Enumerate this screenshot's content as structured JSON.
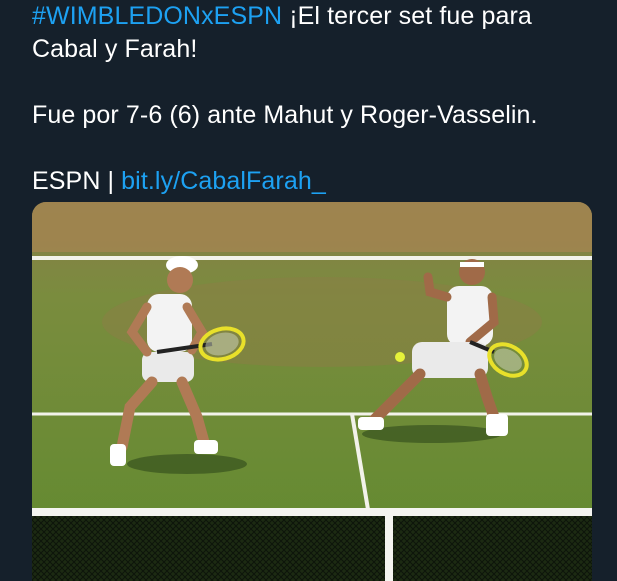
{
  "tweet": {
    "hashtag": "#WIMBLEDONxESPN",
    "line1_rest": " ¡El tercer set fue para",
    "line2": "Cabal y Farah!",
    "paragraph2": "Fue por 7-6 (6) ante Mahut y Roger-Vasselin.",
    "source_label": "ESPN | ",
    "link": "bit.ly/CabalFarah_"
  },
  "media": {
    "description_icon": "photo-tennis-doubles-players",
    "colors": {
      "background": "#15202b",
      "link": "#1da1f2",
      "grass": "#6c8f34",
      "court_dirt": "#a28550"
    }
  }
}
